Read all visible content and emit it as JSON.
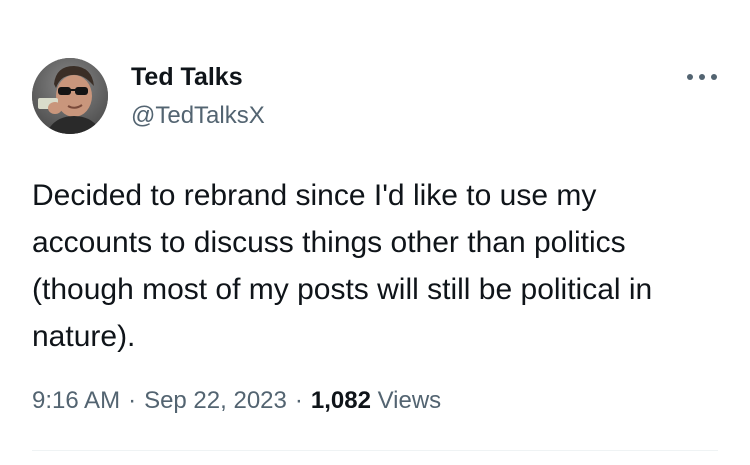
{
  "author": {
    "display_name": "Ted Talks",
    "handle": "@TedTalksX",
    "avatar_icon": "profile-photo"
  },
  "more_icon": "more-horizontal-icon",
  "tweet": {
    "text": "Decided to rebrand since I'd like to use my accounts to discuss things other than politics (though most of my posts will still be political in nature)."
  },
  "meta": {
    "time": "9:16 AM",
    "separator": "·",
    "date": "Sep 22, 2023",
    "views_count": "1,082",
    "views_label": "Views"
  },
  "colors": {
    "text_primary": "#0f1419",
    "text_secondary": "#536471",
    "divider": "#eff3f4"
  }
}
